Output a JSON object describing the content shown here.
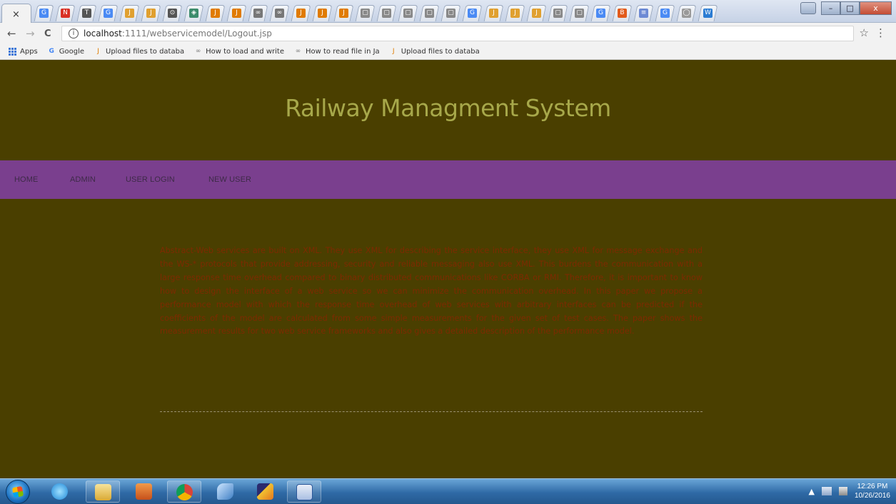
{
  "browser": {
    "close_glyph": "×",
    "nav": {
      "back": "←",
      "forward": "→",
      "reload": "C"
    },
    "url_host": "localhost",
    "url_path": ":1111/webservicemodel/Logout.jsp",
    "info_glyph": "i",
    "star_glyph": "☆",
    "menu_glyph": "⋮",
    "window_controls": {
      "minimize": "–",
      "maximize": "□",
      "close": "x"
    },
    "tab_icons": [
      "G",
      "N",
      "T",
      "G",
      "J",
      "J",
      "⊙",
      "◈",
      "J",
      "J",
      "∞",
      "∞",
      "J",
      "J",
      "J",
      "▢",
      "▢",
      "▢",
      "▢",
      "▢",
      "G",
      "J",
      "J",
      "J",
      "▢",
      "▢",
      "G",
      "B",
      "≡",
      "G",
      "◯",
      "W"
    ],
    "bookmarks": [
      {
        "icon": "apps-icon",
        "label": "Apps"
      },
      {
        "icon": "google-icon",
        "glyph": "G",
        "label": "Google"
      },
      {
        "icon": "upload-icon",
        "glyph": "J",
        "label": "Upload files to databa"
      },
      {
        "icon": "page-icon",
        "glyph": "∞",
        "label": "How to load and write"
      },
      {
        "icon": "page-icon",
        "glyph": "∞",
        "label": "How to read file in Ja"
      },
      {
        "icon": "upload-icon",
        "glyph": "J",
        "label": "Upload files to databa"
      }
    ]
  },
  "page": {
    "title": "Railway Managment System",
    "nav": [
      "HOME",
      "ADMIN",
      "USER LOGIN",
      "NEW USER"
    ],
    "abstract": "Abstract-Web services are built on XML. They use XML for describing the service interface, they use XML for message exchange and the WS-* protocols that provide addressing, security and reliable messaging also use XML. This burdens the communication with a large response time overhead compared to binary distributed communications like CORBA or RMI. Therefore, it is important to know how to design the interface of a web service so we can minimize the communication overhead. In this paper we propose a performance model with which the response time overhead of web services with arbitrary interfaces can be predicted if the coefficients of the model are calculated from some simple measurements for the given set of test cases. The paper shows the measurement results for two web service frameworks and also gives a detailed description of the performance model."
  },
  "taskbar": {
    "apps": [
      "internet-explorer-icon",
      "file-explorer-icon",
      "media-player-icon",
      "chrome-icon",
      "dolphin-icon",
      "wand-icon",
      "word-icon"
    ],
    "tray_up": "▲",
    "time": "12:26 PM",
    "date": "10/26/2016"
  }
}
